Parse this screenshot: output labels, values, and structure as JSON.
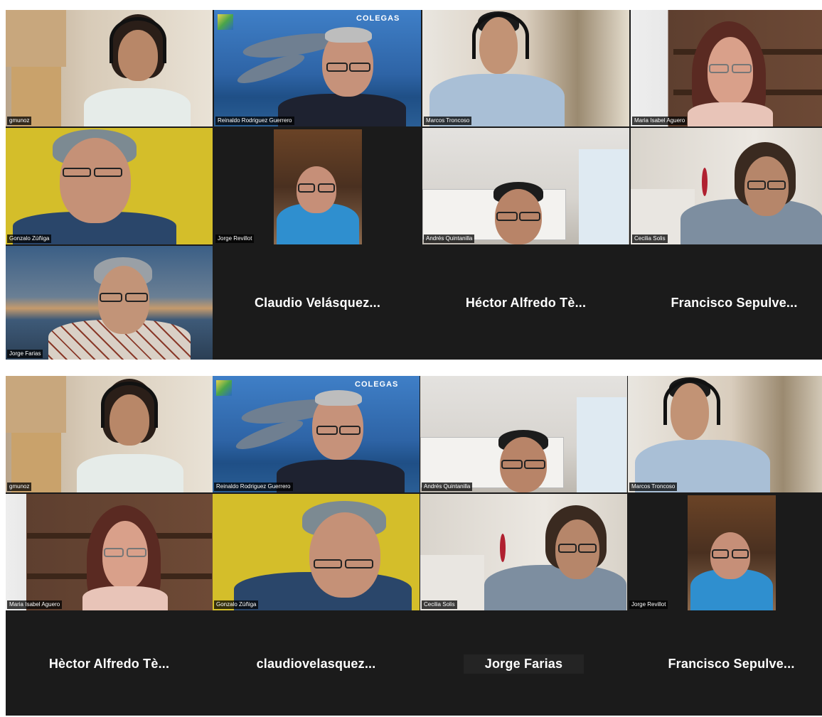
{
  "logo_text": "COLEGAS",
  "panel1": {
    "tiles": [
      {
        "label": "gmunoz"
      },
      {
        "label": "Reinaldo Rodriguez Guerrero"
      },
      {
        "label": "Marcos Troncoso"
      },
      {
        "label": "Maria Isabel Aguero"
      },
      {
        "label": "Gonzalo Zúñiga"
      },
      {
        "label": "Jorge Revillot"
      },
      {
        "label": "Andrés Quintanilla"
      },
      {
        "label": "Cecilia Solis"
      },
      {
        "label": "Jorge Farias"
      }
    ],
    "name_tiles": [
      "Claudio Velásquez...",
      "Héctor Alfredo Tè...",
      "Francisco Sepulve..."
    ]
  },
  "panel2": {
    "tiles": [
      {
        "label": "gmunoz"
      },
      {
        "label": "Reinaldo Rodriguez Guerrero"
      },
      {
        "label": "Andrés Quintanilla"
      },
      {
        "label": "Marcos Troncoso"
      },
      {
        "label": "Maria Isabel Aguero"
      },
      {
        "label": "Gonzalo Zúñiga"
      },
      {
        "label": "Cecilia Solis"
      },
      {
        "label": "Jorge Revillot"
      }
    ],
    "name_tiles": [
      "Hèctor Alfredo Tè...",
      "claudiovelasquez...",
      "Jorge Farias",
      "Francisco Sepulve..."
    ]
  }
}
